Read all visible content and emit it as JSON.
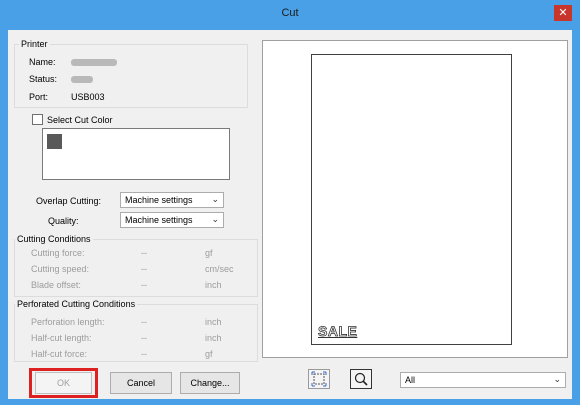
{
  "window": {
    "title": "Cut",
    "close_glyph": "✕"
  },
  "printer": {
    "group_label": "Printer",
    "name_label": "Name:",
    "status_label": "Status:",
    "port_label": "Port:",
    "port_value": "USB003"
  },
  "cut_color": {
    "checkbox_label": "Select Cut Color",
    "checked": false,
    "swatch_color": "#595959"
  },
  "overlap": {
    "label": "Overlap Cutting:",
    "value": "Machine settings"
  },
  "quality": {
    "label": "Quality:",
    "value": "Machine settings"
  },
  "cutting_conditions": {
    "group_label": "Cutting Conditions",
    "rows": [
      {
        "label": "Cutting force:",
        "value": "--",
        "unit": "gf"
      },
      {
        "label": "Cutting speed:",
        "value": "--",
        "unit": "cm/sec"
      },
      {
        "label": "Blade offset:",
        "value": "--",
        "unit": "inch"
      }
    ]
  },
  "perforated": {
    "group_label": "Perforated Cutting Conditions",
    "rows": [
      {
        "label": "Perforation length:",
        "value": "--",
        "unit": "inch"
      },
      {
        "label": "Half-cut length:",
        "value": "--",
        "unit": "inch"
      },
      {
        "label": "Half-cut force:",
        "value": "--",
        "unit": "gf"
      }
    ]
  },
  "buttons": {
    "ok": "OK",
    "cancel": "Cancel",
    "change": "Change..."
  },
  "preview": {
    "artwork_text": "SALE"
  },
  "view": {
    "range_value": "All"
  },
  "icons": {
    "fit": "fit-page-icon",
    "zoom": "magnifier-icon",
    "dropdown": "chevron-down-icon"
  },
  "colors": {
    "titlebar": "#4aa0e6",
    "close": "#c7352b",
    "highlight": "#dd2020"
  }
}
